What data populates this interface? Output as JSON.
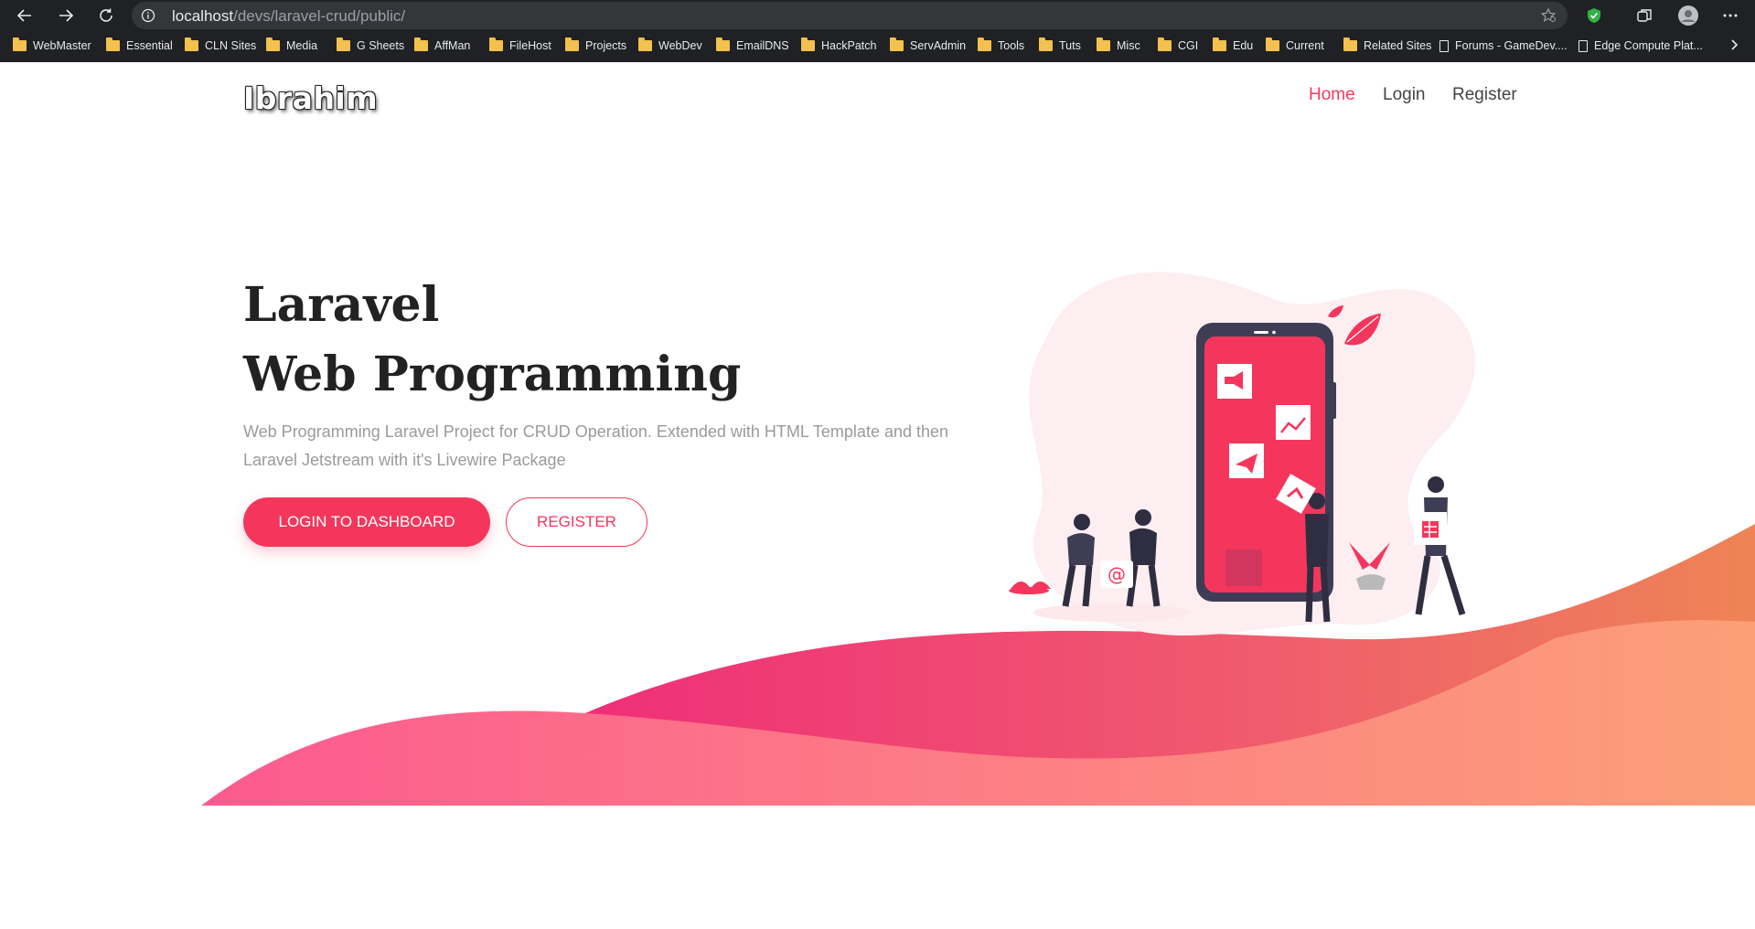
{
  "browser": {
    "url_host": "localhost",
    "url_path": "/devs/laravel-crud/public/",
    "bookmarks": [
      {
        "label": "WebMaster",
        "type": "folder"
      },
      {
        "label": "Essential",
        "type": "folder"
      },
      {
        "label": "CLN Sites",
        "type": "folder"
      },
      {
        "label": "Media",
        "type": "folder"
      },
      {
        "label": "G Sheets",
        "type": "folder"
      },
      {
        "label": "AffMan",
        "type": "folder"
      },
      {
        "label": "FileHost",
        "type": "folder"
      },
      {
        "label": "Projects",
        "type": "folder"
      },
      {
        "label": "WebDev",
        "type": "folder"
      },
      {
        "label": "EmailDNS",
        "type": "folder"
      },
      {
        "label": "HackPatch",
        "type": "folder"
      },
      {
        "label": "ServAdmin",
        "type": "folder"
      },
      {
        "label": "Tools",
        "type": "folder"
      },
      {
        "label": "Tuts",
        "type": "folder"
      },
      {
        "label": "Misc",
        "type": "folder"
      },
      {
        "label": "CGI",
        "type": "folder"
      },
      {
        "label": "Edu",
        "type": "folder"
      },
      {
        "label": "Current",
        "type": "folder"
      },
      {
        "label": "Related Sites",
        "type": "folder"
      },
      {
        "label": "Forums - GameDev....",
        "type": "page"
      },
      {
        "label": "Edge Compute Plat...",
        "type": "page"
      }
    ]
  },
  "site": {
    "brand": "Ibrahim",
    "nav": [
      "Home",
      "Login",
      "Register"
    ],
    "active_nav": "Home"
  },
  "hero": {
    "title_line1": "Laravel",
    "title_line2": "Web Programming",
    "subtitle": "Web Programming Laravel Project for CRUD Operation. Extended with HTML Template and then Laravel Jetstream with it's Livewire Package",
    "primary_button": "LOGIN TO DASHBOARD",
    "secondary_button": "REGISTER"
  },
  "colors": {
    "accent": "#f5365c",
    "wave_pink": "#f0447e",
    "wave_orange": "#f4946a"
  }
}
